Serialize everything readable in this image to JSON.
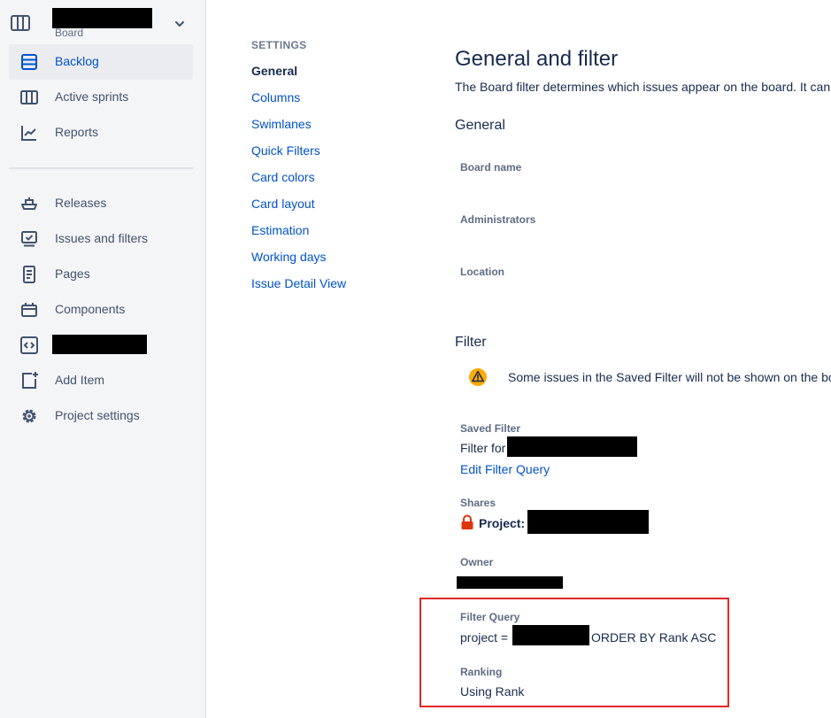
{
  "sidebar": {
    "project_subtitle": "Board",
    "items": [
      {
        "label": "Backlog",
        "icon": "backlog-icon",
        "active": true
      },
      {
        "label": "Active sprints",
        "icon": "board-columns-icon"
      },
      {
        "label": "Reports",
        "icon": "chart-line-icon"
      },
      {
        "label": "Releases",
        "icon": "ship-icon"
      },
      {
        "label": "Issues and filters",
        "icon": "issues-icon"
      },
      {
        "label": "Pages",
        "icon": "page-icon"
      },
      {
        "label": "Components",
        "icon": "component-icon"
      },
      {
        "label": "",
        "icon": "code-icon",
        "redacted": true
      },
      {
        "label": "Add Item",
        "icon": "add-item-icon"
      },
      {
        "label": "Project settings",
        "icon": "gear-icon"
      }
    ]
  },
  "settings_menu": {
    "title": "SETTINGS",
    "items": [
      "General",
      "Columns",
      "Swimlanes",
      "Quick Filters",
      "Card colors",
      "Card layout",
      "Estimation",
      "Working days",
      "Issue Detail View"
    ],
    "current": "General"
  },
  "main": {
    "title": "General and filter",
    "description": "The Board filter determines which issues appear on the board. It can",
    "general_heading": "General",
    "board_name_label": "Board name",
    "administrators_label": "Administrators",
    "location_label": "Location",
    "filter_heading": "Filter",
    "warning_text": "Some issues in the Saved Filter will not be shown on the bo",
    "saved_filter_label": "Saved Filter",
    "saved_filter_prefix": "Filter for",
    "edit_filter_link": "Edit Filter Query",
    "shares_label": "Shares",
    "shares_value": "Project:",
    "owner_label": "Owner",
    "filter_query_label": "Filter Query",
    "filter_query_prefix": "project =",
    "filter_query_suffix": "ORDER BY Rank ASC",
    "ranking_label": "Ranking",
    "ranking_value": "Using Rank"
  },
  "colors": {
    "accent": "#0052cc",
    "highlight_border": "#e02828",
    "warning": "#ffab00",
    "lock": "#de350b"
  }
}
